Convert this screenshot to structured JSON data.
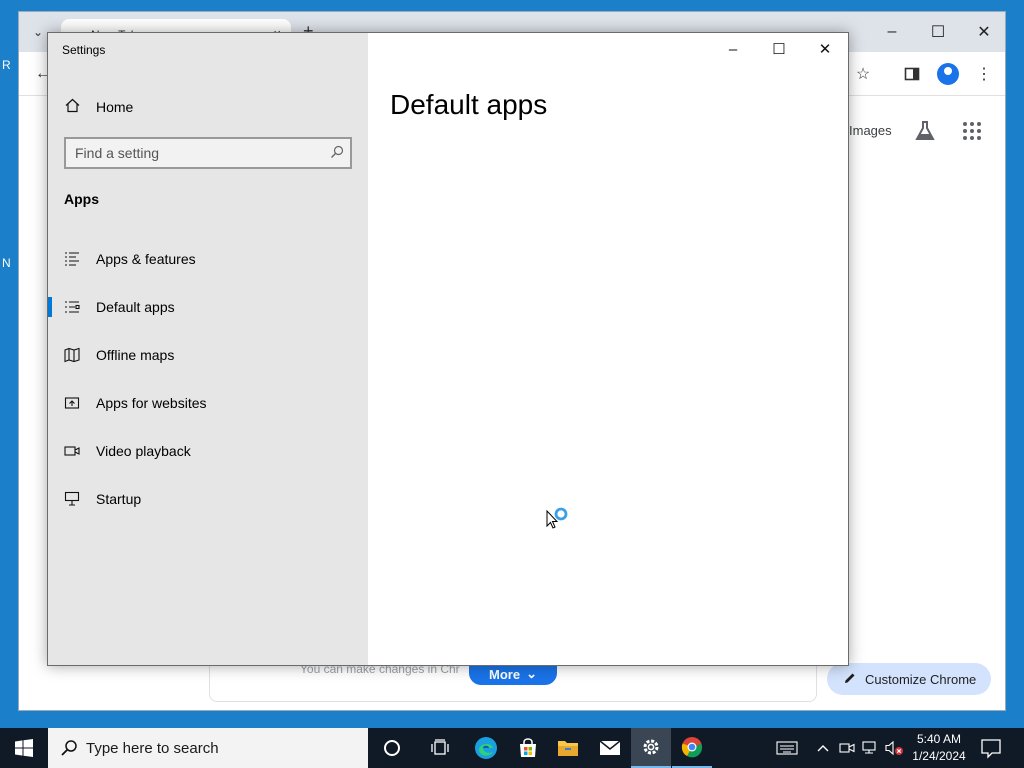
{
  "desktop": {
    "partial_letters": [
      "R",
      "N"
    ]
  },
  "chrome": {
    "tab_title": "New Tab",
    "tab_close": "×",
    "new_tab": "+",
    "images_link": "Images",
    "footer_text": "You can make changes in Chr",
    "more_button": "More",
    "customize_button": "Customize Chrome",
    "window_controls": {
      "minimize": "–",
      "maximize": "☐",
      "close": "✕"
    }
  },
  "settings": {
    "title": "Settings",
    "window_controls": {
      "minimize": "–",
      "maximize": "☐",
      "close": "✕"
    },
    "home_label": "Home",
    "search_placeholder": "Find a setting",
    "section_heading": "Apps",
    "nav": [
      {
        "label": "Apps & features",
        "icon": "apps-features-icon",
        "selected": false
      },
      {
        "label": "Default apps",
        "icon": "default-apps-icon",
        "selected": true
      },
      {
        "label": "Offline maps",
        "icon": "map-icon",
        "selected": false
      },
      {
        "label": "Apps for websites",
        "icon": "open-web-icon",
        "selected": false
      },
      {
        "label": "Video playback",
        "icon": "video-icon",
        "selected": false
      },
      {
        "label": "Startup",
        "icon": "startup-icon",
        "selected": false
      }
    ],
    "content_title": "Default apps"
  },
  "taskbar": {
    "search_placeholder": "Type here to search",
    "apps": [
      "cortana-icon",
      "task-view-icon",
      "edge-icon",
      "store-icon",
      "file-explorer-icon",
      "mail-icon",
      "settings-icon",
      "chrome-icon"
    ],
    "clock": {
      "time": "5:40 AM",
      "date": "1/24/2024"
    }
  },
  "colors": {
    "accent": "#0078d7",
    "taskbar": "#101a26",
    "chrome_blue": "#1a73e8"
  }
}
